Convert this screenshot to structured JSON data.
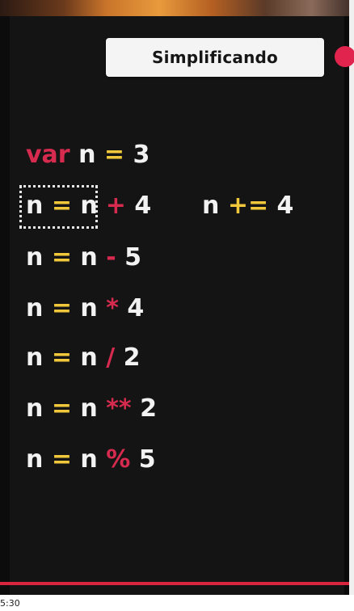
{
  "header": {
    "title": "Simplificando"
  },
  "code": {
    "declaration": {
      "keyword": "var",
      "var_name": "n",
      "assign": "=",
      "value": "3"
    },
    "lines": [
      {
        "lhs": "n",
        "assign": "=",
        "rhs": "n",
        "op": "+",
        "operand": "4"
      },
      {
        "lhs": "n",
        "assign": "=",
        "rhs": "n",
        "op": "-",
        "operand": "5"
      },
      {
        "lhs": "n",
        "assign": "=",
        "rhs": "n",
        "op": "*",
        "operand": "4"
      },
      {
        "lhs": "n",
        "assign": "=",
        "rhs": "n",
        "op": "/",
        "operand": "2"
      },
      {
        "lhs": "n",
        "assign": "=",
        "rhs": "n",
        "op": "**",
        "operand": "2"
      },
      {
        "lhs": "n",
        "assign": "=",
        "rhs": "n",
        "op": "%",
        "operand": "5"
      }
    ],
    "shorthand": {
      "lhs": "n",
      "op": "+=",
      "operand": "4"
    }
  },
  "player": {
    "timestamp": "5:30"
  },
  "colors": {
    "keyword": "#d62b4f",
    "assign": "#f1c83b",
    "background": "#141414",
    "progress": "#d7263d"
  }
}
